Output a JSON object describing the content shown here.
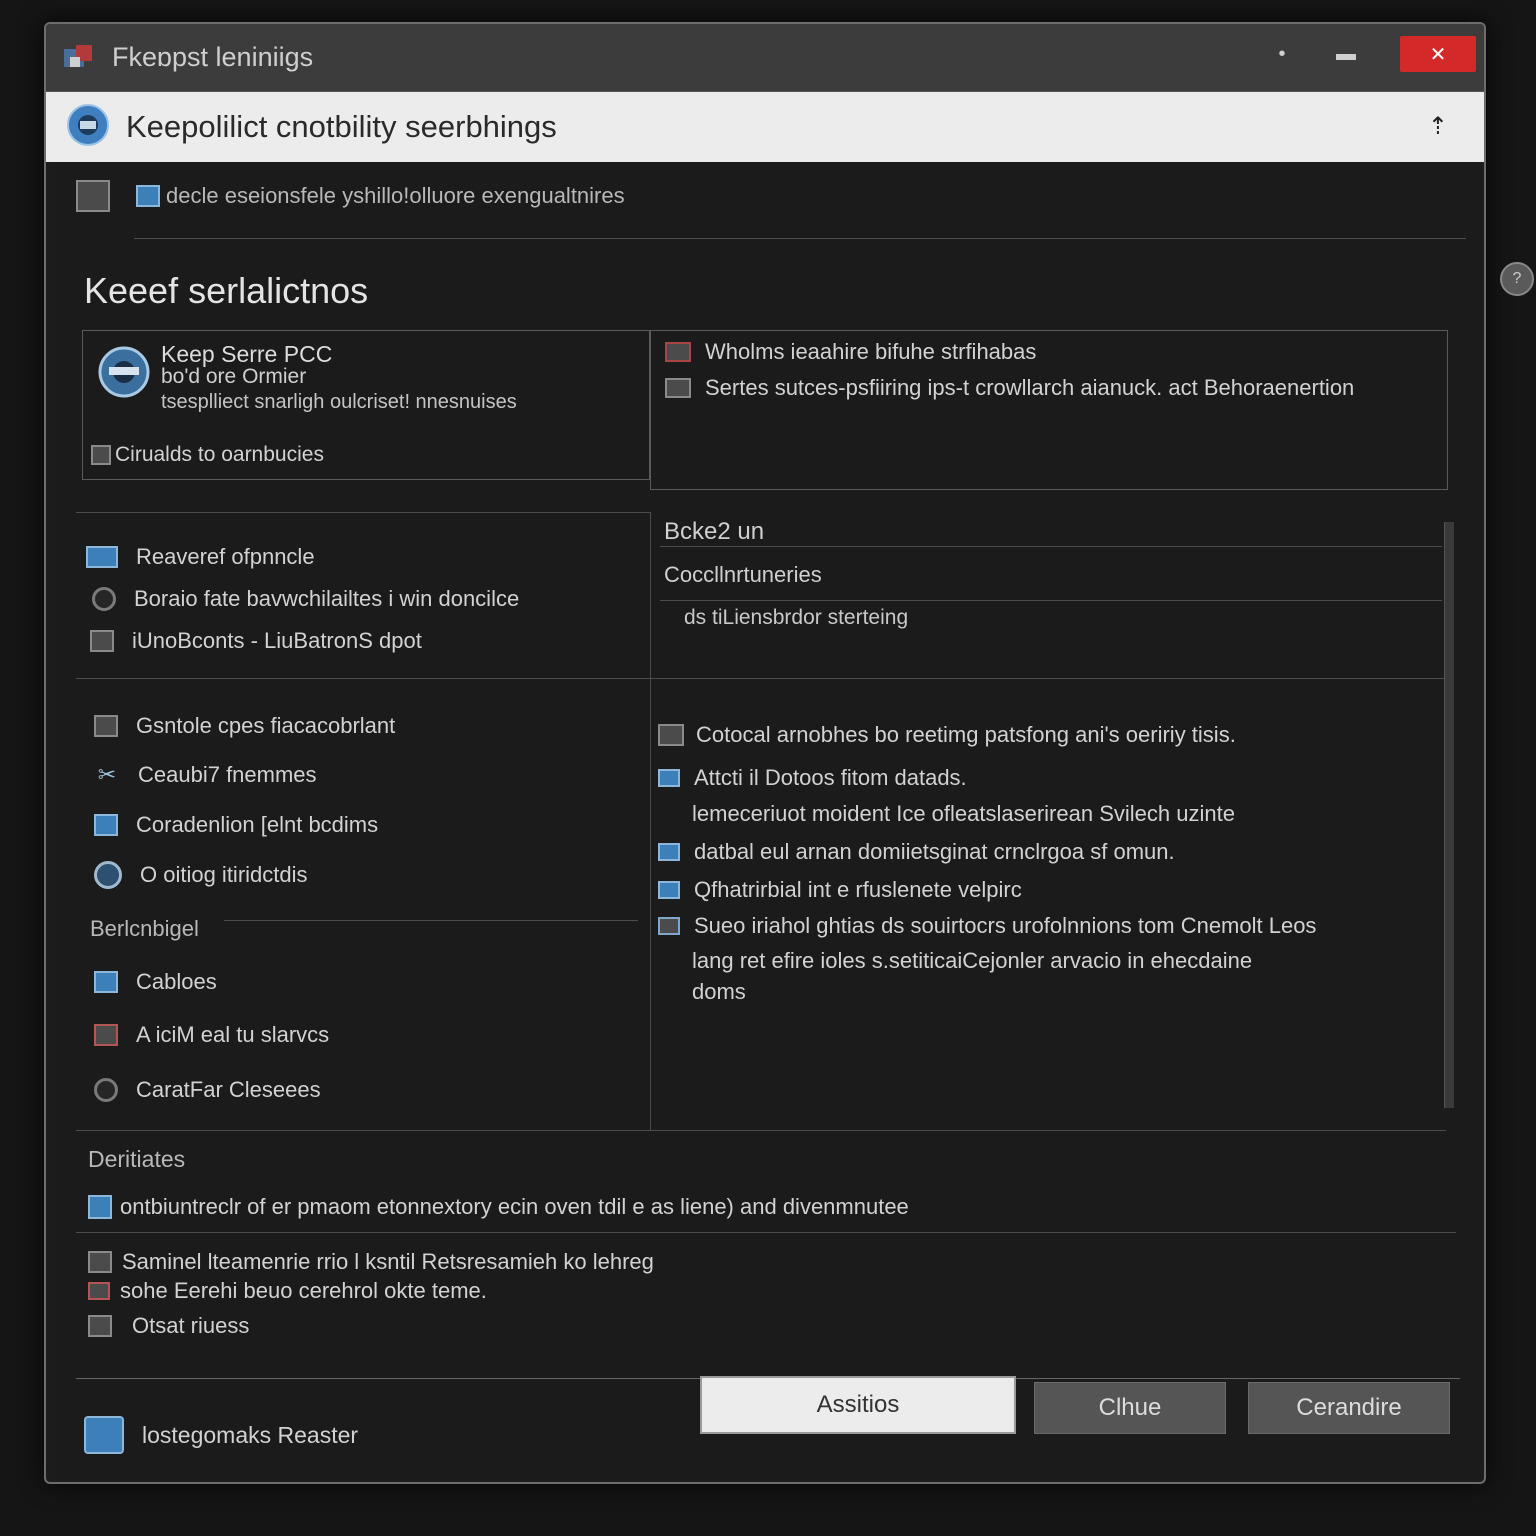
{
  "window": {
    "title": "Fkeɒpst leniniigs",
    "controls": {
      "minimize": "•",
      "maximize": "▬",
      "close": "✕"
    }
  },
  "header": {
    "title": "Keepolilict cnotbility seerbhings",
    "pin": "⇡"
  },
  "toolbar": {
    "path_text": "decle eseionsfele yshillo!olluore exengualtnires"
  },
  "section_title": "Keeef serlalictnos",
  "card_left": {
    "title": "Keep Serre PCC",
    "subtitle": "bo'd ore Ormier",
    "description": "tsesplliect snarligh oulcriset! nnesnuises",
    "link": "Cirualds to oarnbucies"
  },
  "card_right": {
    "items": [
      "Wholms ieaahire bifuhe strfihabas",
      "Sertes sutces-psfiiring ips-t crowllarch aianuck. act Behoraenertion"
    ]
  },
  "left_group1": {
    "items": [
      "Reaveref ofpnncle",
      "Boraio fate bavwchilailtes i win doncilce",
      "iUnoBconts - LiuBatronS dpot"
    ]
  },
  "right_panel": {
    "heading": "Bcke2 un",
    "field_label": "Coccllnrtuneriеs",
    "field_value": "ds tiLiensbrdor sterteing"
  },
  "left_group2": {
    "items": [
      "Gsntole cpes fiacacobrlant",
      "Ceaubi7 fnemmes",
      "Coradenlion [elnt bcdims",
      "O oitiog itiridctdis"
    ]
  },
  "left_group3": {
    "heading": "Berlcnbigel",
    "items": [
      "Cabloes",
      "A iciM eal tu slarvcs",
      "CaratFar Cleseees"
    ]
  },
  "right_list": {
    "items": [
      "Cotocal arnobhes bo reetimg patsfong ani's oeririy tisis.",
      "Attcti il Dotoos fitom datads.",
      "lemeceriuot moident Ice ofleatslaserirean Svilech uzinte",
      "datbal eul arnan domiietsginat crnclrgoa sf omun.",
      "Qfhatrirbial int e rfuslenete velpirc",
      "Sueo iriahol ghtias ds souirtocrs urofolnnions tom Cnemolt Leos",
      "lang ret efire ioles s.setiticaiCejonler arvacio in ehecdaine",
      "doms"
    ]
  },
  "details": {
    "heading": "Deritiates",
    "line1": "ontbiuntreclr of er pmaom etonnextory ecin oven tdil e as liene) and divenmnutee",
    "lines": [
      "Saminel lteamenrie rrio l ksntil Retsresamieh ko lehreg",
      "sohe Eerehi beuo cerehrol okte teme.",
      "Otsat riuess"
    ]
  },
  "footer": {
    "label": "lostegomaks Reaster",
    "btn_primary": "Assitios",
    "btn_secondary": "Clhue",
    "btn_tertiary": "Cerandire"
  }
}
